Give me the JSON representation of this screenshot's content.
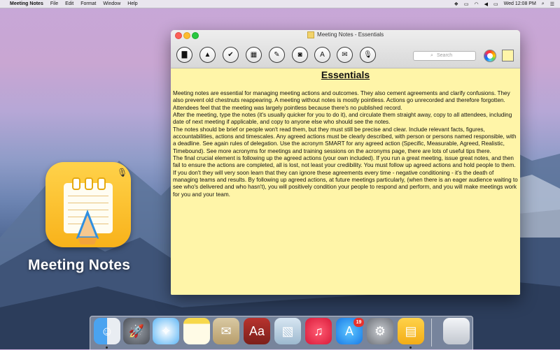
{
  "menubar": {
    "app_name": "Meeting Notes",
    "items": [
      "File",
      "Edit",
      "Format",
      "Window",
      "Help"
    ],
    "clock": "Wed 12:08 PM"
  },
  "window": {
    "title": "Meeting Notes - Essentials",
    "toolbar": {
      "buttons": [
        {
          "name": "new-note-button",
          "glyph": "▇"
        },
        {
          "name": "eject-button",
          "glyph": "▲"
        },
        {
          "name": "checkmark-button",
          "glyph": "✔"
        },
        {
          "name": "print-button",
          "glyph": "▦"
        },
        {
          "name": "brush-button",
          "glyph": "✎"
        },
        {
          "name": "camera-button",
          "glyph": "◙"
        },
        {
          "name": "font-button",
          "glyph": "A"
        },
        {
          "name": "mail-button",
          "glyph": "✉"
        },
        {
          "name": "microphone-button",
          "glyph": "🎙"
        }
      ],
      "search_placeholder": "Search"
    },
    "note": {
      "heading": "Essentials",
      "paragraphs": [
        "Meeting notes are essential for managing meeting actions and outcomes. They also cement agreements and clarify confusions. They also prevent old chestnuts reappearing. A meeting without notes is mostly pointless. Actions go unrecorded and therefore forgotten. Attendees feel that the meeting was largely pointless because there's no published record.",
        "After the meeting, type the notes (it's usually quicker for you to do it), and circulate them straight away, copy to all attendees, including date of next meeting if applicable, and copy to anyone else who should see the notes.",
        "The notes should be brief or people won't read them, but they must still be precise and clear. Include relevant facts, figures, accountabilities, actions and timescales. Any agreed actions must be clearly described, with person or persons named responsible, with a deadline. See again rules of delegation. Use the acronym SMART for any agreed action (Specific, Measurable, Agreed, Realistic, Timebound). See more acronyms for meetings and training sessions on the acronyms page, there are lots of useful tips there.",
        "The final crucial element is following up the agreed actions (your own included). If you run a great meeting, issue great notes, and then fail to ensure the actions are completed, all is lost, not least your credibility. You must follow up agreed actions and hold people to them. If you don't they will very soon learn that they can ignore these agreements every time - negative conditioning - it's the death of managing teams and results. By following up agreed actions, at future meetings particularly, (when there is an eager audience waiting to see who's delivered and who hasn't), you will positively condition your people to respond and perform, and you will make meetings work for you and your team."
      ]
    }
  },
  "desktop": {
    "app_icon_label": "Meeting Notes"
  },
  "dock": {
    "app_store_badge": "19",
    "apps": [
      {
        "name": "finder-icon",
        "bg": "linear-gradient(90deg,#4aa3f0 50%,#e9edf2 50%)",
        "glyph": "☺"
      },
      {
        "name": "launchpad-icon",
        "bg": "radial-gradient(#9aa0a8,#4b4f57)",
        "glyph": "🚀"
      },
      {
        "name": "safari-icon",
        "bg": "radial-gradient(#ffffff,#5bb5f5)",
        "glyph": "✧"
      },
      {
        "name": "notes-icon",
        "bg": "linear-gradient(#f7d84b 22%,#fffbe6 22%)",
        "glyph": ""
      },
      {
        "name": "mail-stamp-icon",
        "bg": "linear-gradient(#d9c9a3,#b79d6a)",
        "glyph": "✉"
      },
      {
        "name": "dictionary-icon",
        "bg": "linear-gradient(#b8332e,#7c1f1a)",
        "glyph": "Aa"
      },
      {
        "name": "preview-icon",
        "bg": "linear-gradient(#d7e6f2,#9db9cf)",
        "glyph": "▧"
      },
      {
        "name": "itunes-icon",
        "bg": "radial-gradient(#ff5c73,#d91a3a)",
        "glyph": "♫"
      },
      {
        "name": "app-store-icon",
        "bg": "radial-gradient(#5fc7ff,#1879e6)",
        "glyph": "A"
      },
      {
        "name": "system-preferences-icon",
        "bg": "radial-gradient(#c9ccd1,#6d7178)",
        "glyph": "⚙"
      },
      {
        "name": "meeting-notes-dock-icon",
        "bg": "linear-gradient(#ffd24a,#f3ad16)",
        "glyph": "▤"
      },
      {
        "name": "trash-icon",
        "bg": "linear-gradient(#f3f5f8,#c2c7cf)",
        "glyph": ""
      }
    ]
  }
}
